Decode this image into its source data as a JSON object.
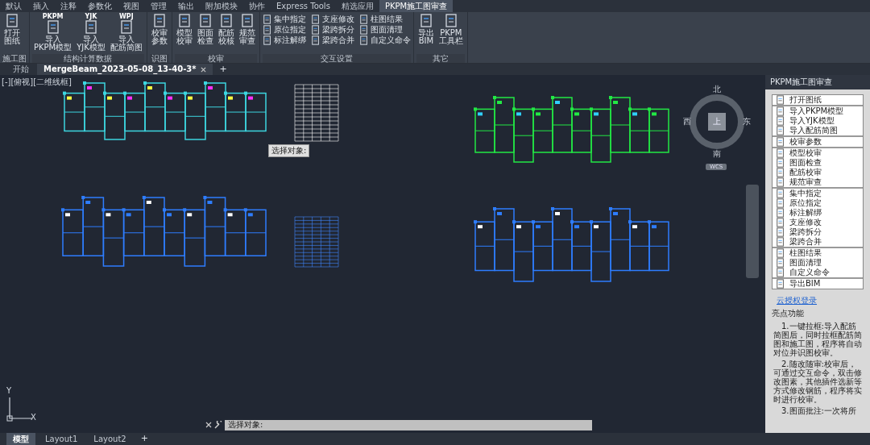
{
  "menu_tabs": [
    {
      "label": "默认",
      "selected": false
    },
    {
      "label": "插入",
      "selected": false
    },
    {
      "label": "注释",
      "selected": false
    },
    {
      "label": "参数化",
      "selected": false
    },
    {
      "label": "视图",
      "selected": false
    },
    {
      "label": "管理",
      "selected": false
    },
    {
      "label": "输出",
      "selected": false
    },
    {
      "label": "附加模块",
      "selected": false
    },
    {
      "label": "协作",
      "selected": false
    },
    {
      "label": "Express Tools",
      "selected": false
    },
    {
      "label": "精选应用",
      "selected": false
    },
    {
      "label": "PKPM施工图审查",
      "selected": true
    }
  ],
  "ribbon_groups": [
    {
      "label": "施工图",
      "buttons": [
        {
          "kind": "large",
          "lines": [
            "打开",
            "图纸"
          ]
        }
      ]
    },
    {
      "label": "结构计算数据",
      "buttons": [
        {
          "kind": "large",
          "icon_text": "PKPM",
          "lines": [
            "导入",
            "PKPM模型"
          ]
        },
        {
          "kind": "large",
          "icon_text": "YJK",
          "lines": [
            "导入",
            "YJK模型"
          ]
        },
        {
          "kind": "large",
          "icon_text": "WPJ",
          "lines": [
            "导入",
            "配筋简图"
          ]
        }
      ]
    },
    {
      "label": "识图",
      "buttons": [
        {
          "kind": "large",
          "lines": [
            "校审",
            "参数"
          ]
        }
      ]
    },
    {
      "label": "校审",
      "buttons": [
        {
          "kind": "large",
          "lines": [
            "模型",
            "校审"
          ]
        },
        {
          "kind": "large",
          "lines": [
            "图面",
            "检查"
          ]
        },
        {
          "kind": "large",
          "lines": [
            "配筋",
            "校核"
          ]
        },
        {
          "kind": "large",
          "lines": [
            "规范",
            "审查"
          ]
        }
      ]
    },
    {
      "label": "交互设置",
      "buttons": [
        {
          "kind": "small",
          "lines": [
            "集中指定"
          ]
        },
        {
          "kind": "small",
          "lines": [
            "原位指定"
          ]
        },
        {
          "kind": "small",
          "lines": [
            "标注解绑"
          ]
        },
        {
          "kind": "small",
          "lines": [
            "支座修改"
          ]
        },
        {
          "kind": "small",
          "lines": [
            "梁跨拆分"
          ]
        },
        {
          "kind": "small",
          "lines": [
            "梁跨合并"
          ]
        },
        {
          "kind": "small",
          "lines": [
            "柱图结果"
          ]
        },
        {
          "kind": "small",
          "lines": [
            "图面清理"
          ]
        },
        {
          "kind": "small",
          "lines": [
            "自定义命令"
          ]
        }
      ]
    },
    {
      "label": "其它",
      "buttons": [
        {
          "kind": "large",
          "lines": [
            "导出",
            "BIM"
          ]
        },
        {
          "kind": "large",
          "lines": [
            "PKPM",
            "工具栏"
          ]
        }
      ]
    }
  ],
  "doc_tabs": [
    {
      "label": "开始",
      "selected": false,
      "closable": false
    },
    {
      "label": "MergeBeam_2023-05-08_13-40-3*",
      "selected": true,
      "closable": true
    }
  ],
  "doc_new_tab": "+",
  "viewport": {
    "label": "[-][俯视][二维线框]",
    "tooltip": "选择对象:",
    "compass": {
      "north": "北",
      "south": "南",
      "east": "东",
      "west": "西",
      "center": "上",
      "wcs": "WCS"
    },
    "ucs": {
      "x": "X",
      "y": "Y"
    }
  },
  "command_line": {
    "prompt": "选择对象:"
  },
  "panel": {
    "title": "PKPM施工图审查",
    "groups": [
      {
        "items": [
          "打开图纸"
        ]
      },
      {
        "items": [
          "导入PKPM模型",
          "导入YJK模型",
          "导入配筋简图"
        ]
      },
      {
        "items": [
          "校审参数"
        ]
      },
      {
        "items": [
          "模型校审",
          "图面检查",
          "配筋校审",
          "规范审查"
        ]
      },
      {
        "items": [
          "集中指定",
          "原位指定",
          "标注解绑",
          "支座修改",
          "梁跨拆分",
          "梁跨合并"
        ]
      },
      {
        "items": [
          "柱图结果",
          "图面清理",
          "自定义命令"
        ]
      },
      {
        "items": [
          "导出BIM"
        ]
      }
    ],
    "link": "云授权登录",
    "section_title": "亮点功能",
    "paragraphs": [
      "1.一键拉框:导入配筋简图后，同时拉框配筋简图和施工图，程序将自动对位并识图校审。",
      "2.随改随审:校审后，可通过交互命令，双击修改图素，其他插件选新等方式修改钢筋，程序将实时进行校审。",
      "3.图面批注:一次将所"
    ]
  },
  "layout_tabs": [
    {
      "label": "模型",
      "selected": true
    },
    {
      "label": "Layout1",
      "selected": false
    },
    {
      "label": "Layout2",
      "selected": false
    }
  ],
  "layout_new_tab": "+"
}
